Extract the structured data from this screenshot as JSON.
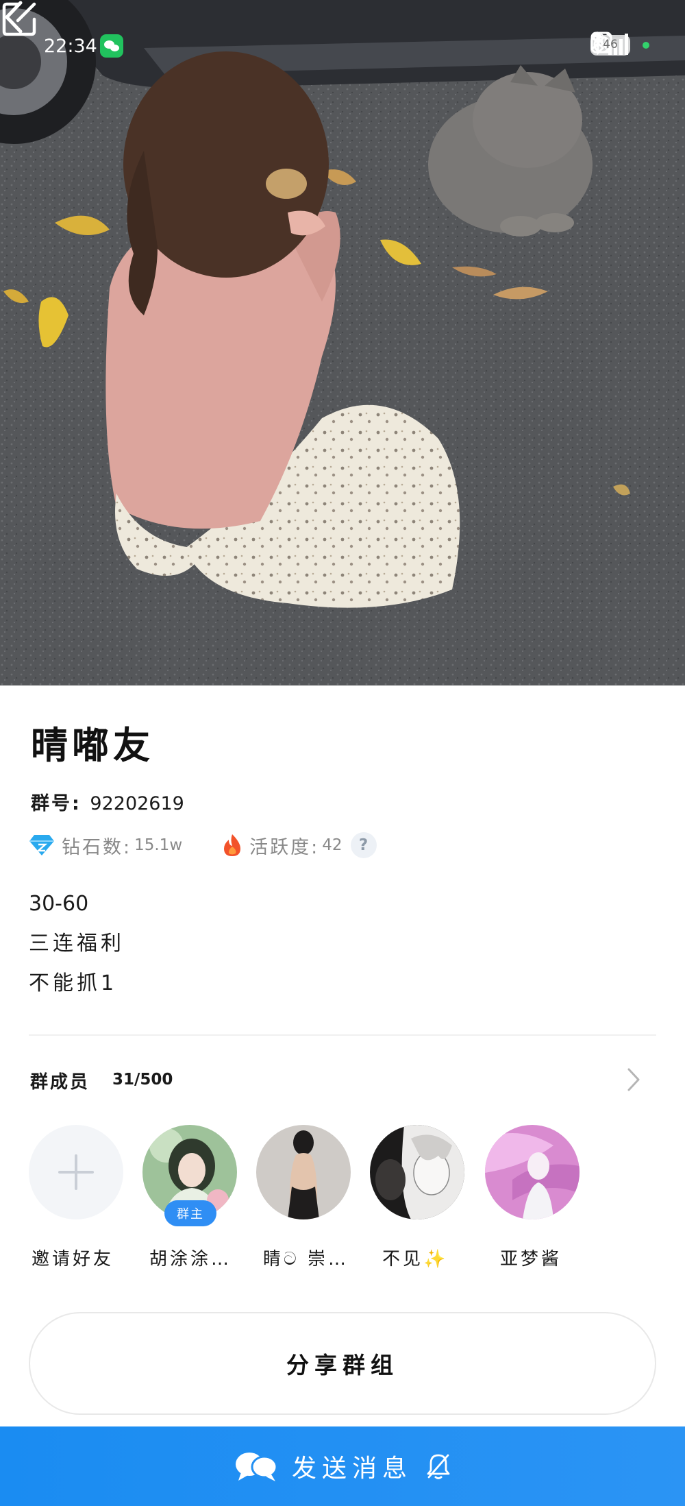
{
  "status_bar": {
    "time": "22:34",
    "network": "5G",
    "battery": "46"
  },
  "group": {
    "name": "晴嘟友",
    "id_label": "群号:",
    "id_value": "92202619",
    "diamonds_label": "钻石数:",
    "diamonds_value": "15.1w",
    "activity_label": "活跃度:",
    "activity_value": "42",
    "help": "?",
    "description": [
      "30-60",
      "三连福利",
      "不能抓1"
    ]
  },
  "members": {
    "title": "群成员",
    "count": "31/500",
    "invite_label": "邀请好友",
    "owner_badge": "群主",
    "list": [
      {
        "name": "胡涂涂…",
        "avatar_color": "#8fae8a"
      },
      {
        "name": "睛ට 崇…",
        "avatar_color": "#3a3838"
      },
      {
        "name": "不见✨",
        "avatar_color": "#d8d6d4"
      },
      {
        "name": "亚梦酱",
        "avatar_color": "#e7a6d8"
      }
    ]
  },
  "share_button": "分享群组",
  "send_button": "发送消息",
  "colors": {
    "accent": "#2b94f4",
    "owner_badge": "#2f8ef4",
    "diamond": "#29a9ee",
    "fire": "#f2522a"
  }
}
